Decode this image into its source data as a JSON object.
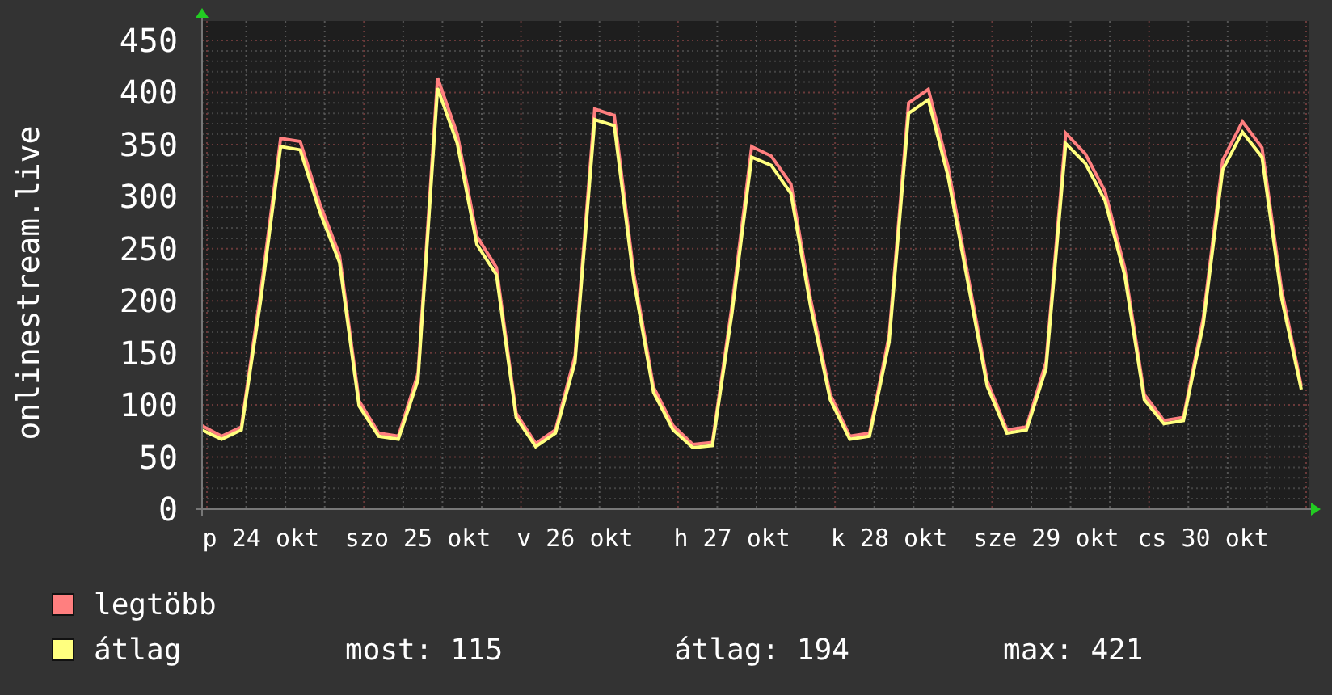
{
  "chart": {
    "chart_data": {
      "type": "line",
      "ylabel": "onlinestream.live",
      "categories": [
        null,
        null,
        null,
        "p 24 okt",
        null,
        null,
        null,
        null,
        null,
        null,
        null,
        "szo 25 okt",
        null,
        null,
        null,
        null,
        null,
        null,
        null,
        "v 26 okt",
        null,
        null,
        null,
        null,
        null,
        null,
        null,
        "h 27 okt",
        null,
        null,
        null,
        null,
        null,
        null,
        null,
        "k 28 okt",
        null,
        null,
        null,
        null,
        null,
        null,
        null,
        "sze 29 okt",
        null,
        null,
        null,
        null,
        null,
        null,
        null,
        "cs 30 okt",
        null,
        null,
        null,
        null,
        null
      ],
      "series": [
        {
          "name": "legtöbb",
          "color": "#ff7f7f",
          "values": [
            80,
            70,
            79,
            210,
            356,
            353,
            293,
            244,
            104,
            73,
            70,
            130,
            414,
            360,
            262,
            232,
            92,
            63,
            76,
            147,
            384,
            378,
            226,
            117,
            80,
            62,
            64,
            196,
            348,
            339,
            312,
            202,
            110,
            70,
            73,
            166,
            390,
            403,
            329,
            226,
            123,
            76,
            79,
            141,
            361,
            341,
            305,
            232,
            110,
            85,
            88,
            183,
            335,
            372,
            347,
            210,
            118
          ]
        },
        {
          "name": "átlag",
          "color": "#ffff7f",
          "values": [
            76,
            67,
            76,
            202,
            348,
            345,
            285,
            237,
            99,
            70,
            67,
            124,
            404,
            351,
            254,
            225,
            88,
            60,
            73,
            141,
            374,
            368,
            219,
            112,
            76,
            59,
            61,
            189,
            338,
            330,
            303,
            195,
            105,
            67,
            70,
            160,
            380,
            393,
            320,
            219,
            118,
            73,
            76,
            135,
            351,
            332,
            296,
            225,
            105,
            82,
            85,
            177,
            326,
            362,
            338,
            202,
            115
          ]
        }
      ],
      "grid": true,
      "ylim": [
        0,
        450
      ],
      "yticks": [
        0,
        50,
        100,
        150,
        200,
        250,
        300,
        350,
        400,
        450
      ]
    }
  },
  "stats": [
    "most: 115",
    "átlag: 194",
    "max: 421"
  ]
}
